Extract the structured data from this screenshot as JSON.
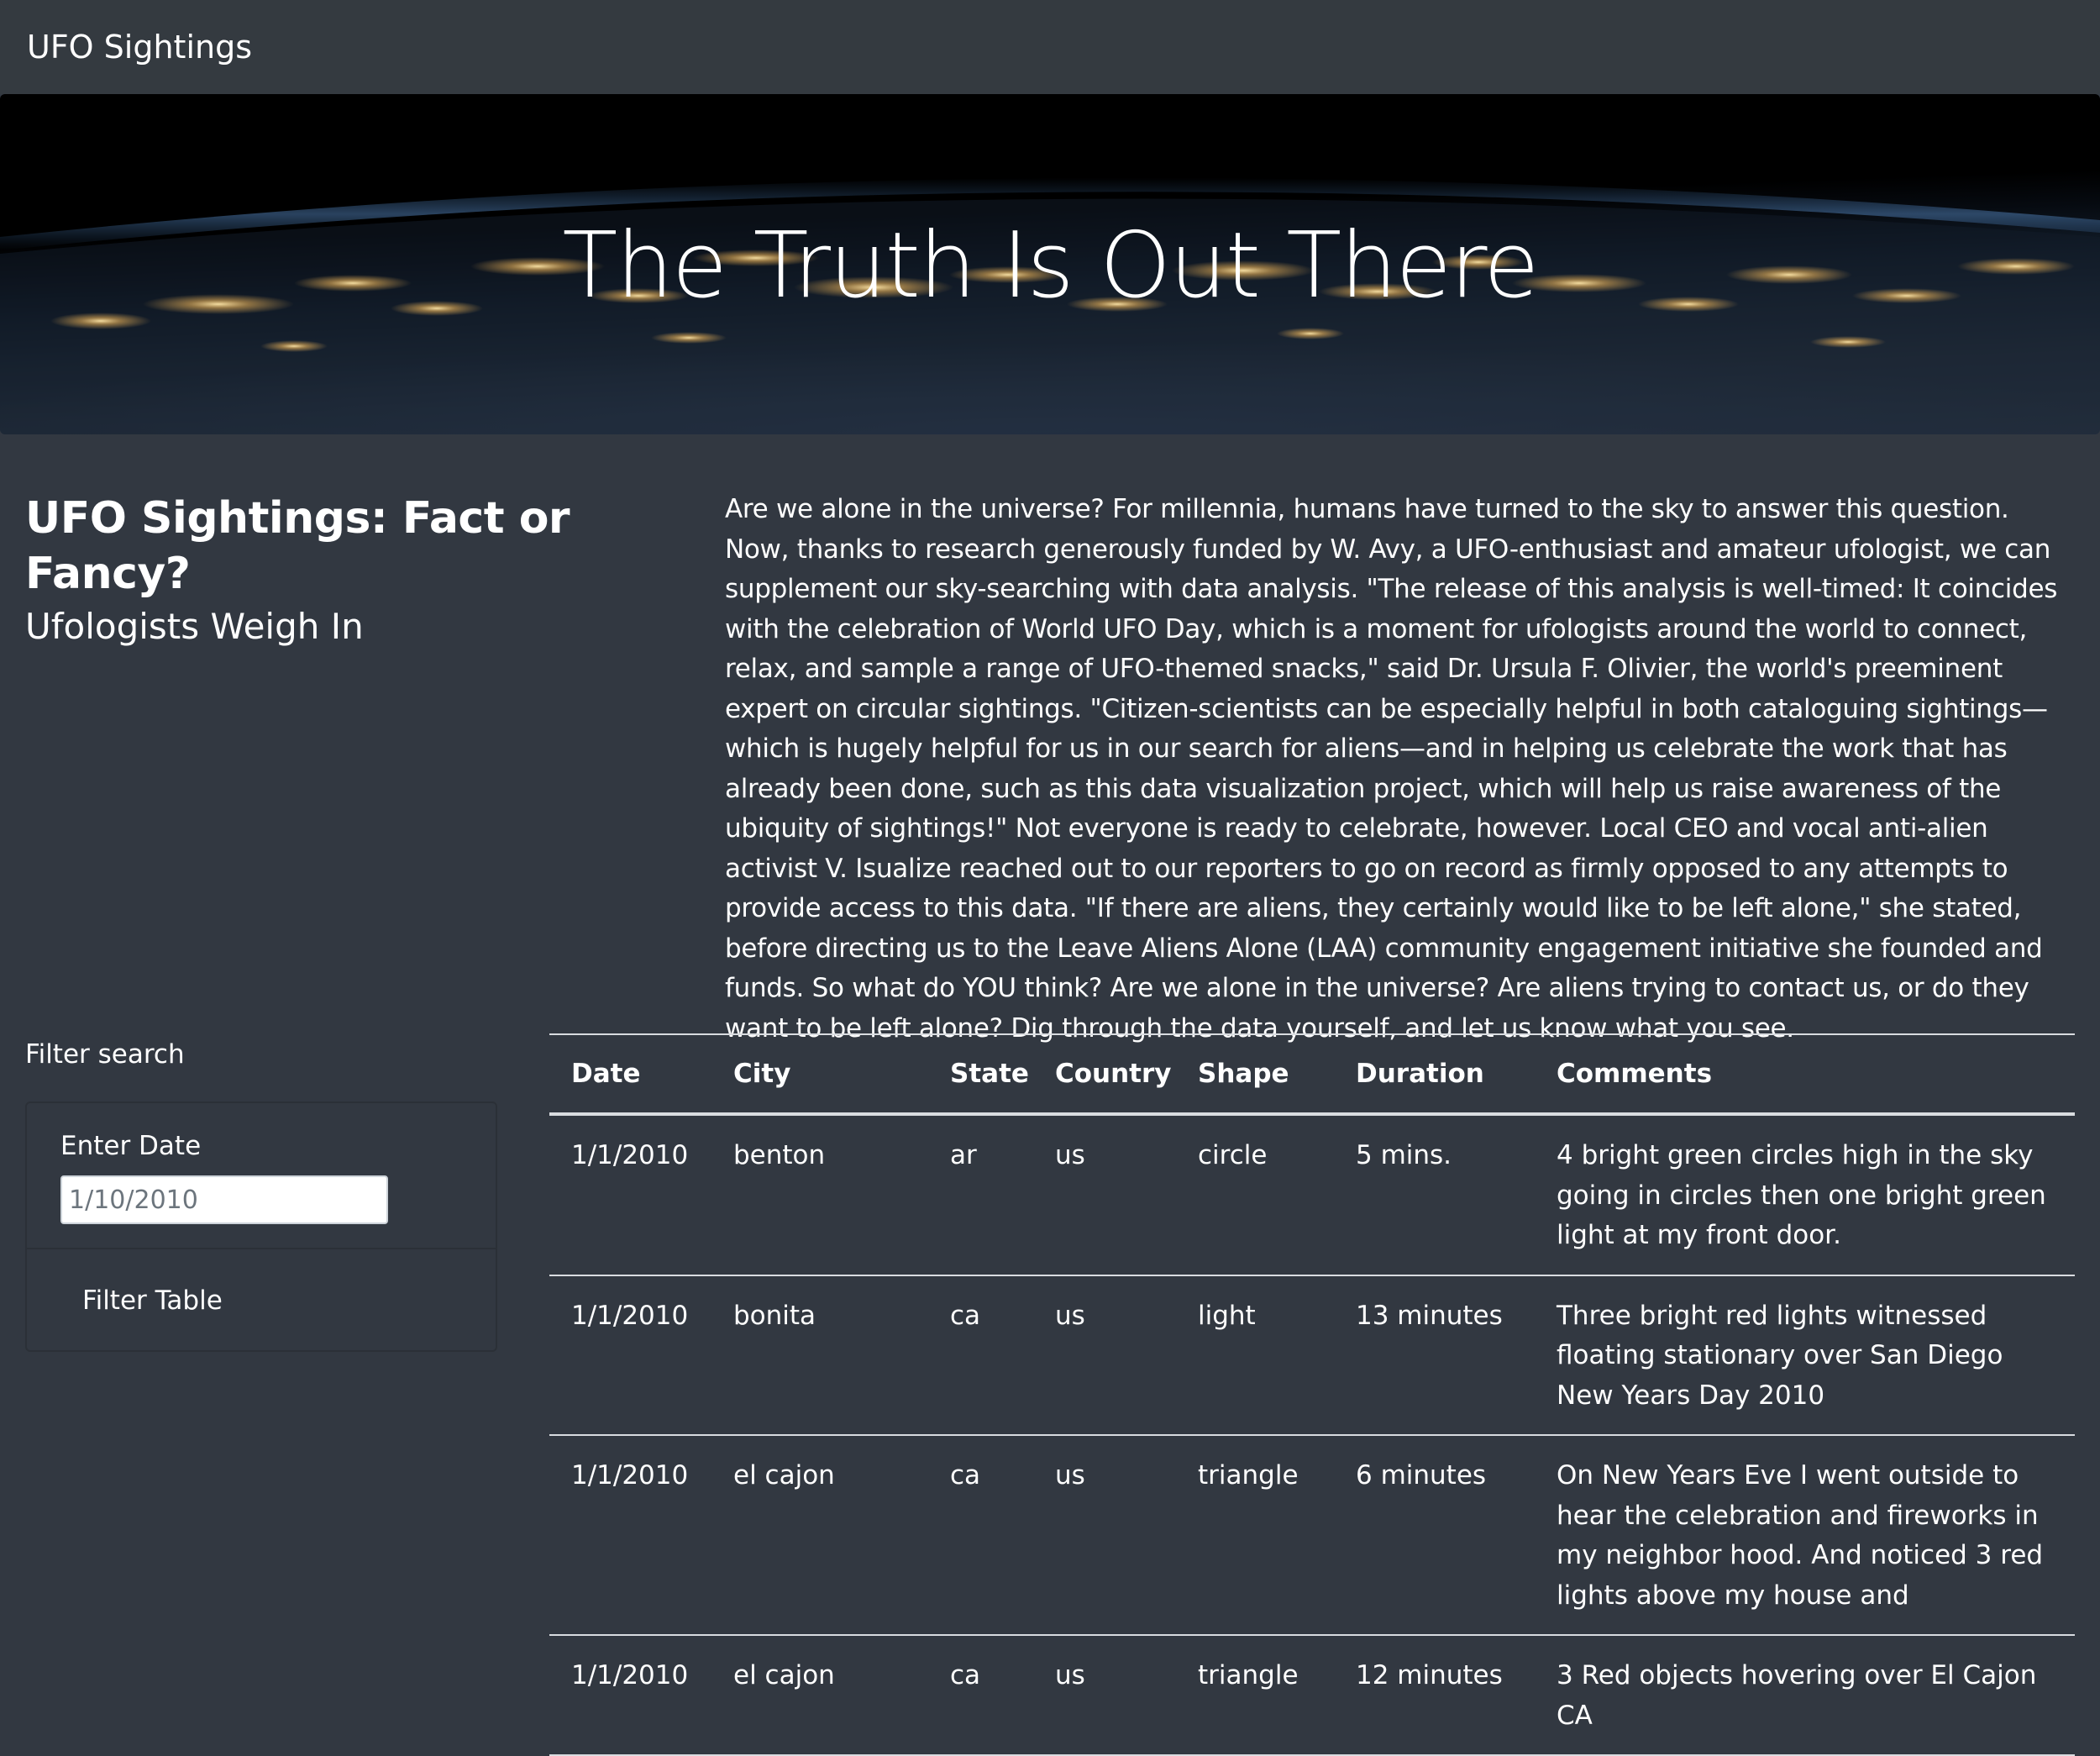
{
  "nav": {
    "brand": "UFO Sightings"
  },
  "hero": {
    "title": "The Truth Is Out There"
  },
  "intro": {
    "title": "UFO Sightings: Fact or Fancy?",
    "subtitle": "Ufologists Weigh In",
    "article": "Are we alone in the universe? For millennia, humans have turned to the sky to answer this question. Now, thanks to research generously funded by W. Avy, a UFO-enthusiast and amateur ufologist, we can supplement our sky-searching with data analysis. \"The release of this analysis is well-timed: It coincides with the celebration of World UFO Day, which is a moment for ufologists around the world to connect, relax, and sample a range of UFO-themed snacks,\" said Dr. Ursula F. Olivier, the world's preeminent expert on circular sightings. \"Citizen-scientists can be especially helpful in both cataloguing sightings—which is hugely helpful for us in our search for aliens—and in helping us celebrate the work that has already been done, such as this data visualization project, which will help us raise awareness of the ubiquity of sightings!\" Not everyone is ready to celebrate, however. Local CEO and vocal anti-alien activist V. Isualize reached out to our reporters to go on record as firmly opposed to any attempts to provide access to this data. \"If there are aliens, they certainly would like to be left alone,\" she stated, before directing us to the Leave Aliens Alone (LAA) community engagement initiative she founded and funds. So what do YOU think? Are we alone in the universe? Are aliens trying to contact us, or do they want to be left alone? Dig through the data yourself, and let us know what you see."
  },
  "filter": {
    "heading": "Filter search",
    "date_label": "Enter Date",
    "date_placeholder": "1/10/2010",
    "button_label": "Filter Table"
  },
  "table": {
    "headers": [
      "Date",
      "City",
      "State",
      "Country",
      "Shape",
      "Duration",
      "Comments"
    ],
    "rows": [
      [
        "1/1/2010",
        "benton",
        "ar",
        "us",
        "circle",
        "5 mins.",
        "4 bright green circles high in the sky going in circles then one bright green light at my front door."
      ],
      [
        "1/1/2010",
        "bonita",
        "ca",
        "us",
        "light",
        "13 minutes",
        "Three bright red lights witnessed floating stationary over San Diego New Years Day 2010"
      ],
      [
        "1/1/2010",
        "el cajon",
        "ca",
        "us",
        "triangle",
        "6 minutes",
        "On New Years Eve I went outside to hear the celebration and fireworks in my neighbor hood. And noticed 3 red lights above my house and"
      ],
      [
        "1/1/2010",
        "el cajon",
        "ca",
        "us",
        "triangle",
        "12 minutes",
        "3 Red objects hovering over El Cajon CA"
      ]
    ]
  }
}
